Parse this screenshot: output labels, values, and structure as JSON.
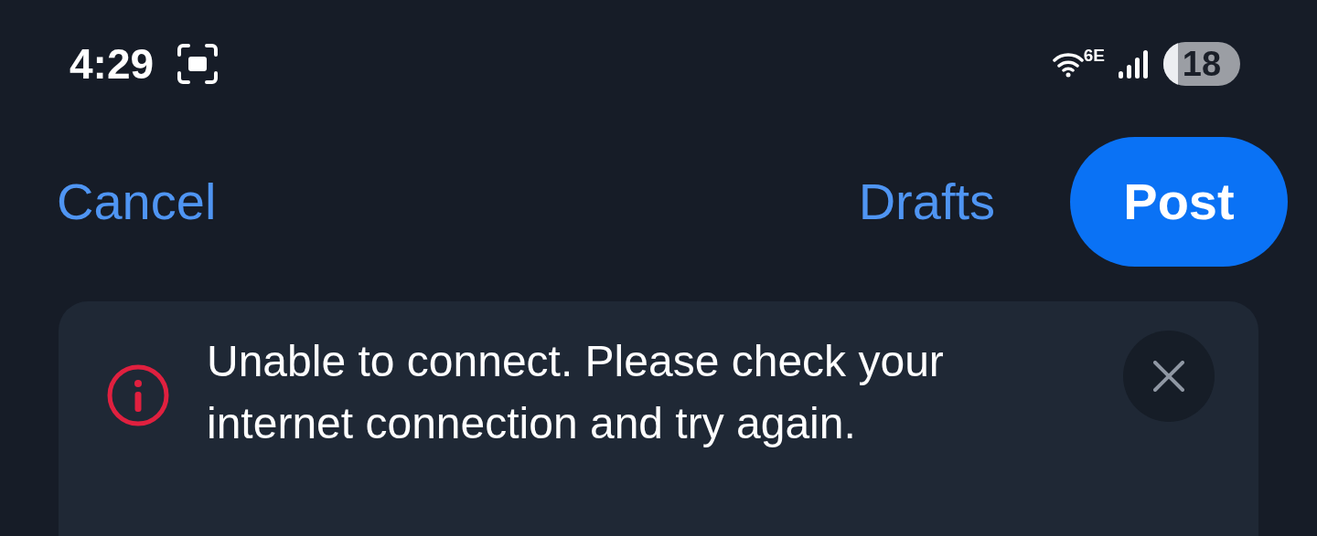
{
  "status_bar": {
    "time": "4:29",
    "wifi_label": "6E",
    "battery": "18"
  },
  "nav": {
    "cancel": "Cancel",
    "drafts": "Drafts",
    "post": "Post"
  },
  "banner": {
    "message": "Unable to connect. Please check your internet connection and try again."
  }
}
